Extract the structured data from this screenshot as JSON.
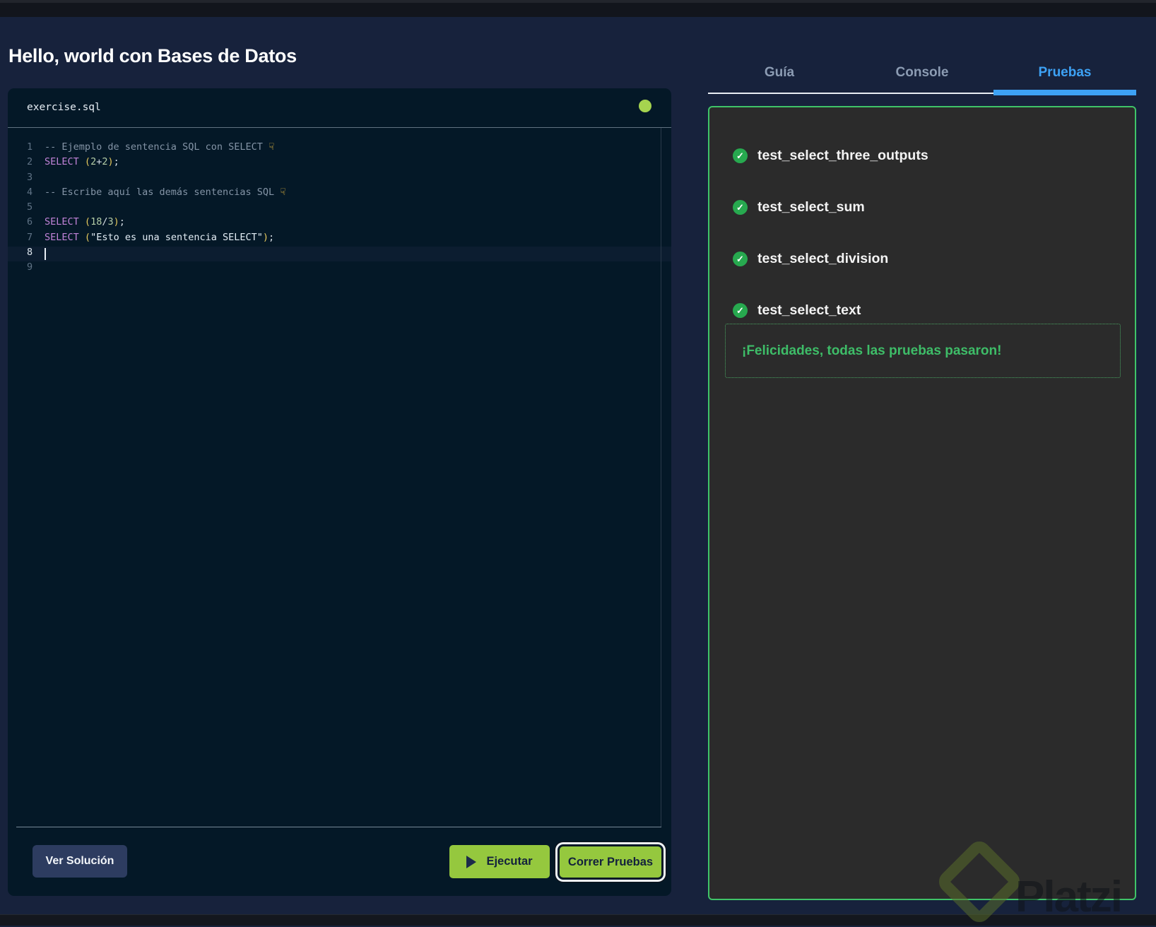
{
  "page": {
    "title": "Hello, world con Bases de Datos"
  },
  "editor": {
    "filename": "exercise.sql",
    "status_dot_color": "#a6d44f",
    "lines": [
      {
        "num": "1",
        "tokens": [
          {
            "text": "-- Ejemplo de sentencia SQL con SELECT ",
            "type": "comment"
          },
          {
            "text": "☟",
            "type": "emoji"
          }
        ]
      },
      {
        "num": "2",
        "tokens": [
          {
            "text": "SELECT",
            "type": "keyword"
          },
          {
            "text": " ",
            "type": "plain"
          },
          {
            "text": "(",
            "type": "paren"
          },
          {
            "text": "2",
            "type": "number"
          },
          {
            "text": "+",
            "type": "operator"
          },
          {
            "text": "2",
            "type": "number"
          },
          {
            "text": ")",
            "type": "paren"
          },
          {
            "text": ";",
            "type": "plain"
          }
        ]
      },
      {
        "num": "3",
        "tokens": []
      },
      {
        "num": "4",
        "tokens": [
          {
            "text": "-- Escribe aquí las demás sentencias SQL ",
            "type": "comment"
          },
          {
            "text": "☟",
            "type": "emoji"
          }
        ]
      },
      {
        "num": "5",
        "tokens": []
      },
      {
        "num": "6",
        "tokens": [
          {
            "text": "SELECT",
            "type": "keyword"
          },
          {
            "text": " ",
            "type": "plain"
          },
          {
            "text": "(",
            "type": "paren"
          },
          {
            "text": "18",
            "type": "number"
          },
          {
            "text": "/",
            "type": "operator"
          },
          {
            "text": "3",
            "type": "number"
          },
          {
            "text": ")",
            "type": "paren"
          },
          {
            "text": ";",
            "type": "plain"
          }
        ]
      },
      {
        "num": "7",
        "tokens": [
          {
            "text": "SELECT",
            "type": "keyword"
          },
          {
            "text": " ",
            "type": "plain"
          },
          {
            "text": "(",
            "type": "paren"
          },
          {
            "text": "\"Esto es una sentencia SELECT\"",
            "type": "string"
          },
          {
            "text": ")",
            "type": "paren"
          },
          {
            "text": ";",
            "type": "plain"
          }
        ]
      },
      {
        "num": "8",
        "tokens": [],
        "current": true,
        "cursor": true
      },
      {
        "num": "9",
        "tokens": []
      }
    ],
    "syntax_colors": {
      "comment": "#8494a6",
      "keyword": "#c183d8",
      "paren": "#e6c95c",
      "number": "#b5cea8",
      "operator": "#d4dce4",
      "string": "#e4eef6",
      "plain": "#d4dce4",
      "emoji": "#f0c040"
    }
  },
  "buttons": {
    "view_solution": "Ver Solución",
    "run": "Ejecutar",
    "run_tests": "Correr Pruebas",
    "green": "#95c83e",
    "navy": "#2d3c60"
  },
  "tabs": [
    {
      "label": "Guía",
      "active": false
    },
    {
      "label": "Console",
      "active": false
    },
    {
      "label": "Pruebas",
      "active": true
    }
  ],
  "tabs_accent_color": "#3da2f5",
  "tests": {
    "panel_border_color": "#3fc468",
    "check_icon": "✓",
    "check_color": "#27a94f",
    "items": [
      {
        "name": "test_select_three_outputs",
        "status": "passed"
      },
      {
        "name": "test_select_sum",
        "status": "passed"
      },
      {
        "name": "test_select_division",
        "status": "passed"
      },
      {
        "name": "test_select_text",
        "status": "passed"
      }
    ],
    "success_message": "¡Felicidades, todas las pruebas pasaron!",
    "success_color": "#3ebd68"
  },
  "watermark": {
    "text": "Platzi"
  }
}
